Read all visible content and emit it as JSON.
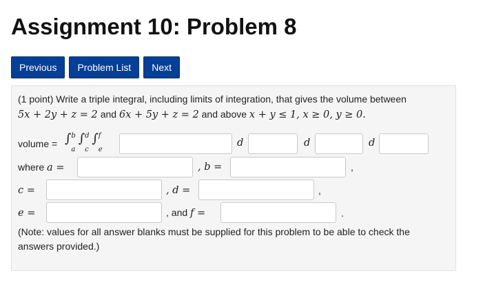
{
  "page": {
    "title": "Assignment 10: Problem 8"
  },
  "nav": {
    "previous": "Previous",
    "problem_list": "Problem List",
    "next": "Next"
  },
  "problem": {
    "points": "(1 point)",
    "statement": "Write a triple integral, including limits of integration, that gives the volume between",
    "plane1": "5x + 2y + z = 2",
    "and1": "and",
    "plane2": "6x + 5y + z = 2",
    "and_above": "and above",
    "region": "x + y ≤ 1, x ≥ 0, y ≥ 0.",
    "volume_label": "volume =",
    "integral_sign": "∫",
    "limits": {
      "a": "a",
      "b": "b",
      "c": "c",
      "d": "d",
      "e": "e",
      "f": "f"
    },
    "d_label": "d",
    "where_label": "where",
    "a_eq": "a =",
    "b_eq": ", b =",
    "c_eq": "c =",
    "d_eq": ", d =",
    "e_eq": "e =",
    "and_f": ", and",
    "f_eq": "f =",
    "comma": ",",
    "period": ".",
    "note": "(Note: values for all answer blanks must be supplied for this problem to be able to check the answers provided.)"
  }
}
